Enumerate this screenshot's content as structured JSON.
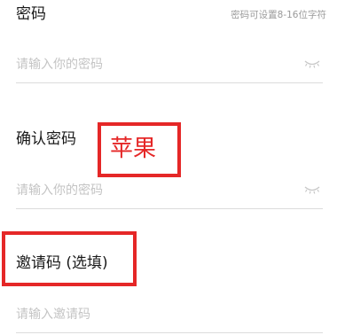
{
  "password": {
    "label": "密码",
    "hint": "密码可设置8-16位字符",
    "placeholder": "请输入你的密码"
  },
  "confirm_password": {
    "label": "确认密码",
    "placeholder": "请输入你的密码"
  },
  "invite_code": {
    "label": "邀请码 (选填)",
    "placeholder": "请输入邀请码"
  },
  "annotation": {
    "text": "苹果",
    "color": "#e52727"
  },
  "icons": {
    "toggle_visibility": "eye-closed-icon"
  }
}
